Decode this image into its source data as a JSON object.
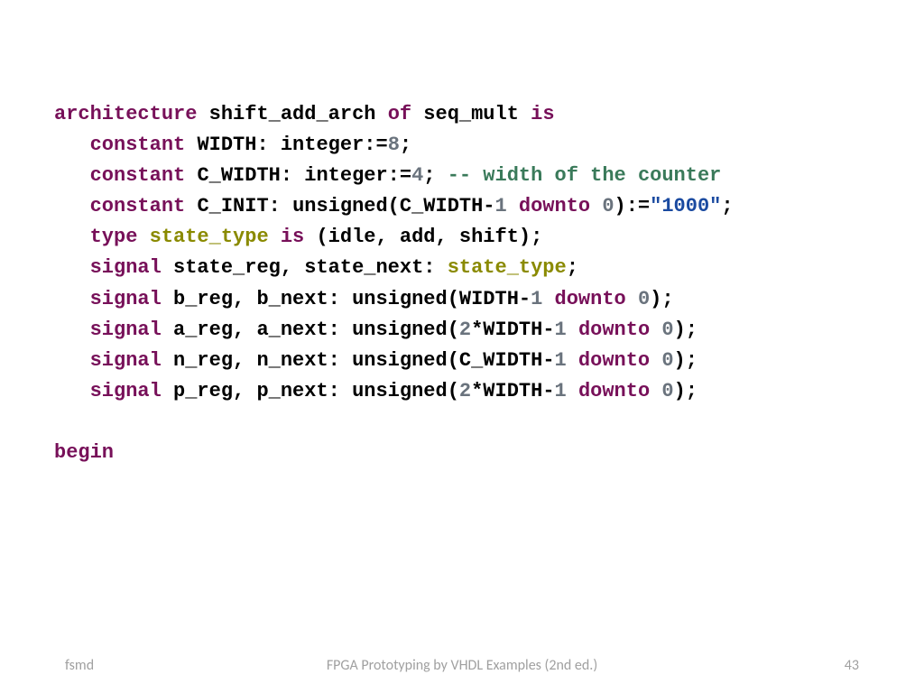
{
  "code": {
    "l1": {
      "kw1": "architecture",
      "id1": "shift_add_arch",
      "kw2": "of",
      "id2": "seq_mult",
      "kw3": "is"
    },
    "l2": {
      "kw": "constant",
      "id": "WIDTH:",
      "typ": "integer:=",
      "num": "8",
      "semi": ";"
    },
    "l3": {
      "kw": "constant",
      "id": "C_WIDTH:",
      "typ": "integer:=",
      "num": "4",
      "semi": ";",
      "cmt": "-- width of the counter"
    },
    "l4": {
      "kw": "constant",
      "id": "C_INIT:",
      "typ": "unsigned(C_WIDTH-",
      "num1": "1",
      "kw2": "downto",
      "num2": "0",
      "close": "):=",
      "str": "\"1000\"",
      "semi": ";"
    },
    "l5": {
      "kw": "type",
      "typ": "state_type",
      "kw2": "is",
      "rest": "(idle, add, shift);"
    },
    "l6": {
      "kw": "signal",
      "id": "state_reg, state_next:",
      "typ": "state_type",
      "semi": ";"
    },
    "l7": {
      "kw": "signal",
      "id": "b_reg, b_next:",
      "typ": "unsigned(WIDTH-",
      "num1": "1",
      "kw2": "downto",
      "num2": "0",
      "close": ");"
    },
    "l8": {
      "kw": "signal",
      "id": "a_reg, a_next:",
      "typ": "unsigned(",
      "num0": "2",
      "mid": "*WIDTH-",
      "num1": "1",
      "kw2": "downto",
      "num2": "0",
      "close": ");"
    },
    "l9": {
      "kw": "signal",
      "id": "n_reg, n_next:",
      "typ": "unsigned(C_WIDTH-",
      "num1": "1",
      "kw2": "downto",
      "num2": "0",
      "close": ");"
    },
    "l10": {
      "kw": "signal",
      "id": "p_reg, p_next:",
      "typ": "unsigned(",
      "num0": "2",
      "mid": "*WIDTH-",
      "num1": "1",
      "kw2": "downto",
      "num2": "0",
      "close": ");"
    },
    "l11": {
      "kw": "begin"
    }
  },
  "footer": {
    "left": "fsmd",
    "center": "FPGA Prototyping by VHDL Examples (2nd ed.)",
    "right": "43"
  }
}
